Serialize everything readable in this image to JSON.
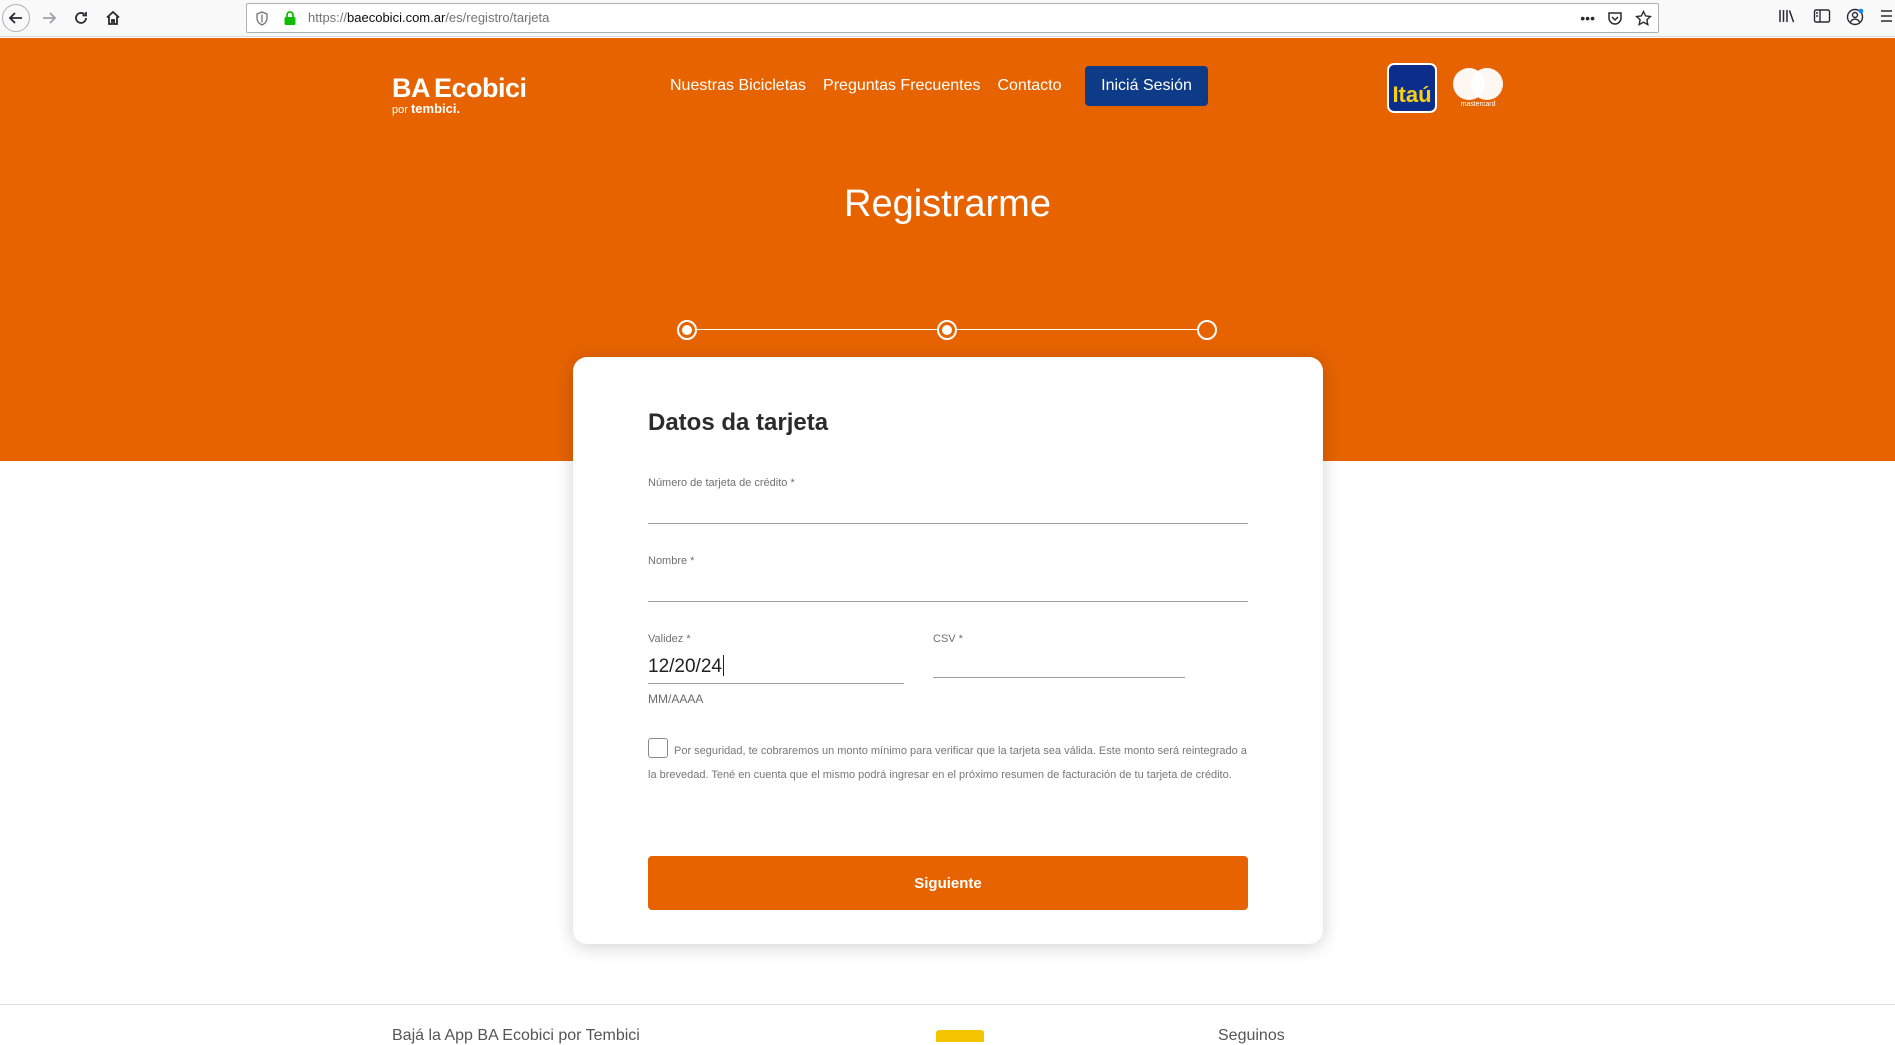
{
  "browser": {
    "url_scheme": "https://",
    "url_host": "baecobici.com.ar",
    "url_path": "/es/registro/tarjeta",
    "more_label": "•••"
  },
  "header": {
    "logo_ba": "BA",
    "logo_name": "Ecobici",
    "logo_by": "por",
    "logo_brand": "tembici.",
    "nav": [
      "Nuestras Bicicletas",
      "Preguntas Frecuentes",
      "Contacto"
    ],
    "login_label": "Iniciá Sesión",
    "sponsor_bank": "Itaú",
    "sponsor_card": "mastercard"
  },
  "page": {
    "title": "Registrarme",
    "steps": {
      "total": 3,
      "completed": 2
    }
  },
  "form": {
    "title": "Datos da tarjeta",
    "card_number": {
      "label": "Número de tarjeta de crédito *",
      "value": ""
    },
    "name": {
      "label": "Nombre *",
      "value": ""
    },
    "expiry": {
      "label": "Validez *",
      "value": "12/20/24",
      "hint": "MM/AAAA"
    },
    "csv": {
      "label": "CSV *",
      "value": ""
    },
    "disclaimer": "Por seguridad, te cobraremos un monto mínimo para verificar que la tarjeta sea válida. Este monto será reintegrado a la brevedad. Tené en cuenta que el mismo podrá ingresar en el próximo resumen de facturación de tu tarjeta de crédito.",
    "submit_label": "Siguiente"
  },
  "footer": {
    "app_text": "Bajá la App BA Ecobici por Tembici",
    "follow_text": "Seguinos"
  },
  "colors": {
    "brand_orange": "#e66300",
    "login_blue": "#0d3b87",
    "itau_blue": "#0d2d8a",
    "itau_yellow": "#f7d117"
  }
}
